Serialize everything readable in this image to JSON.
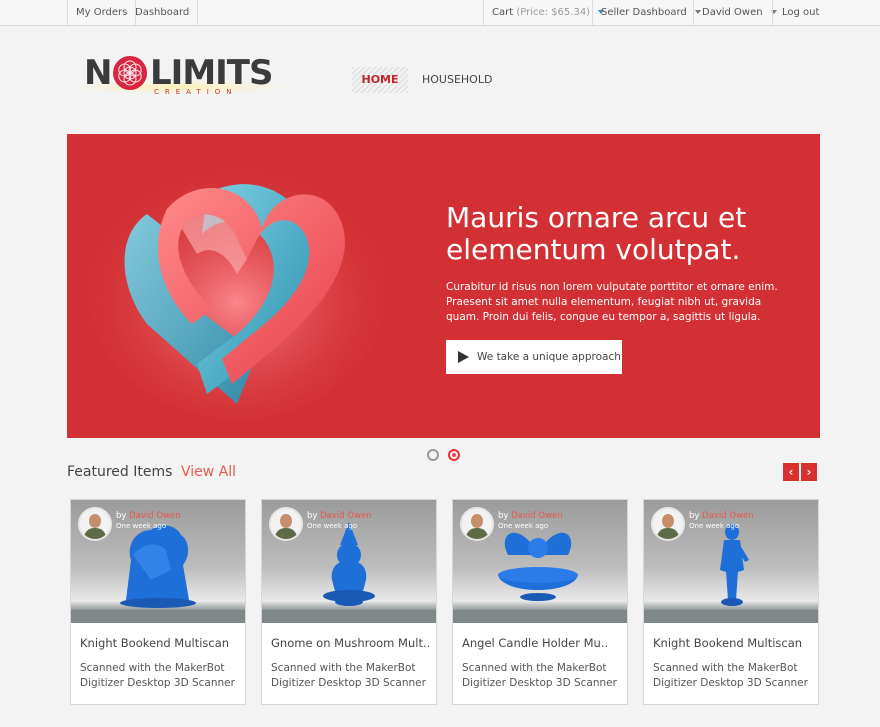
{
  "topbar": {
    "my_orders": "My Orders",
    "dashboard": "Dashboard",
    "cart_label": "Cart",
    "cart_price": "(Price: $65.34)",
    "seller_dashboard": "Seller Dashboard",
    "user": "David Owen",
    "logout": "Log out"
  },
  "logo": {
    "n": "N",
    "rest": "LIMITS",
    "tagline": "CREATION"
  },
  "nav": {
    "home": "HOME",
    "household": "HOUSEHOLD"
  },
  "hero": {
    "title": "Mauris ornare arcu et elementum volutpat.",
    "text": "Curabitur id risus non lorem vulputate porttitor et ornare enim. Praesent sit amet nulla elementum, feugiat nibh ut, gravida quam. Proin dui felis, congue eu tempor a, sagittis ut ligula.",
    "button": "We take a unique approach"
  },
  "featured": {
    "title": "Featured Items",
    "view_all": "View All",
    "prev": "‹",
    "next": "›"
  },
  "cards": [
    {
      "by": "by",
      "author": "David Owen",
      "ago": "One week ago",
      "name": "Knight Bookend Multiscan",
      "desc": "Scanned with the MakerBot Digitizer Desktop 3D Scanner"
    },
    {
      "by": "by",
      "author": "David Owen",
      "ago": "One week ago",
      "name": "Gnome on Mushroom Mult..",
      "desc": "Scanned with the MakerBot Digitizer Desktop 3D Scanner"
    },
    {
      "by": "by",
      "author": "David Owen",
      "ago": "One week ago",
      "name": "Angel Candle Holder Mu..",
      "desc": "Scanned with the MakerBot Digitizer Desktop 3D Scanner"
    },
    {
      "by": "by",
      "author": "David Owen",
      "ago": "One week ago",
      "name": "Knight Bookend Multiscan",
      "desc": "Scanned with the MakerBot Digitizer Desktop 3D Scanner"
    }
  ],
  "colors": {
    "accent_red": "#d23034",
    "link": "#e8584b",
    "model_blue": "#1f6fd8"
  },
  "icons": {
    "play": "play-icon",
    "prev": "chevron-left-icon",
    "next": "chevron-right-icon",
    "caret": "caret-down-icon"
  }
}
